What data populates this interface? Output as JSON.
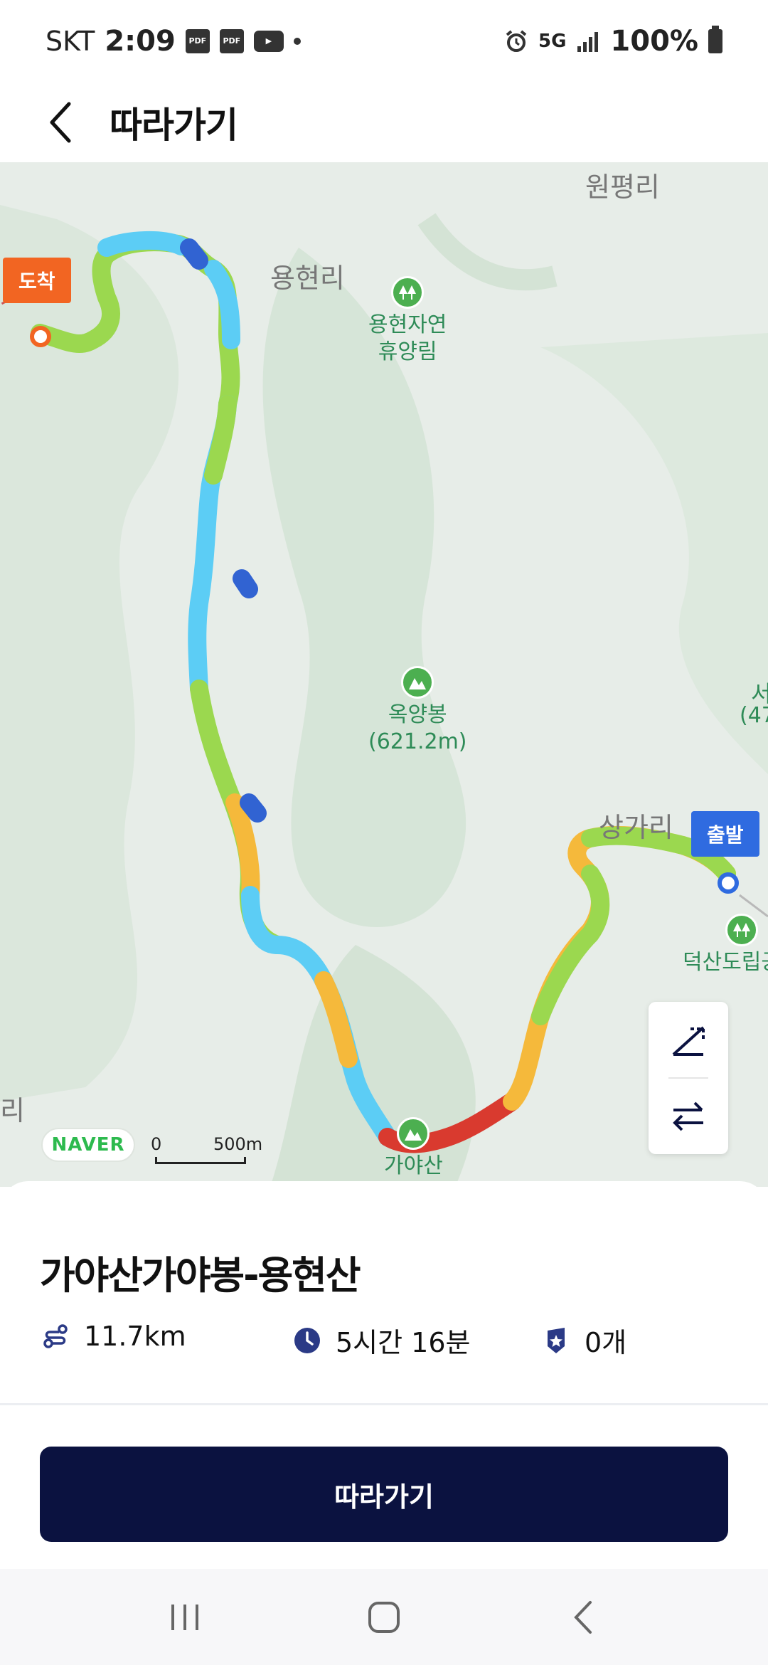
{
  "status_bar": {
    "carrier": "SKT",
    "time": "2:09",
    "notif_icons": [
      "pdf-icon",
      "pdf-icon",
      "youtube-icon",
      "dot-icon"
    ],
    "network": "5G",
    "battery": "100%"
  },
  "header": {
    "title": "따라가기",
    "back_icon": "chevron-left-icon"
  },
  "map": {
    "area_labels": [
      "원평리",
      "용현리",
      "상가리",
      "서",
      "(47",
      "리"
    ],
    "pois": [
      {
        "name_line1": "용현자연",
        "name_line2": "휴양림"
      },
      {
        "name_line1": "옥양봉",
        "name_line2": "(621.2m)"
      },
      {
        "name_line1": "가야산",
        "name_line2": ""
      },
      {
        "name_line1": "덕산도립공",
        "name_line2": ""
      }
    ],
    "arrive_label": "도착",
    "start_label": "출발",
    "naver_logo": "NAVER",
    "scale_zero": "0",
    "scale_value": "500m",
    "controls": [
      "route-slope-icon",
      "swap-direction-icon"
    ],
    "route_colors": {
      "steep": "#d93a2f",
      "up": "#f5b93b",
      "flat": "#9bd84f",
      "down": "#5ccdf5",
      "steepdown": "#3163d2"
    }
  },
  "course": {
    "name": "가야산가야봉-용현산",
    "distance": "11.7km",
    "time": "5시간 16분",
    "badges": "0개"
  },
  "actions": {
    "follow_label": "따라가기"
  },
  "nav_bar": {
    "buttons": [
      "recent-apps-icon",
      "home-icon",
      "back-icon"
    ]
  }
}
